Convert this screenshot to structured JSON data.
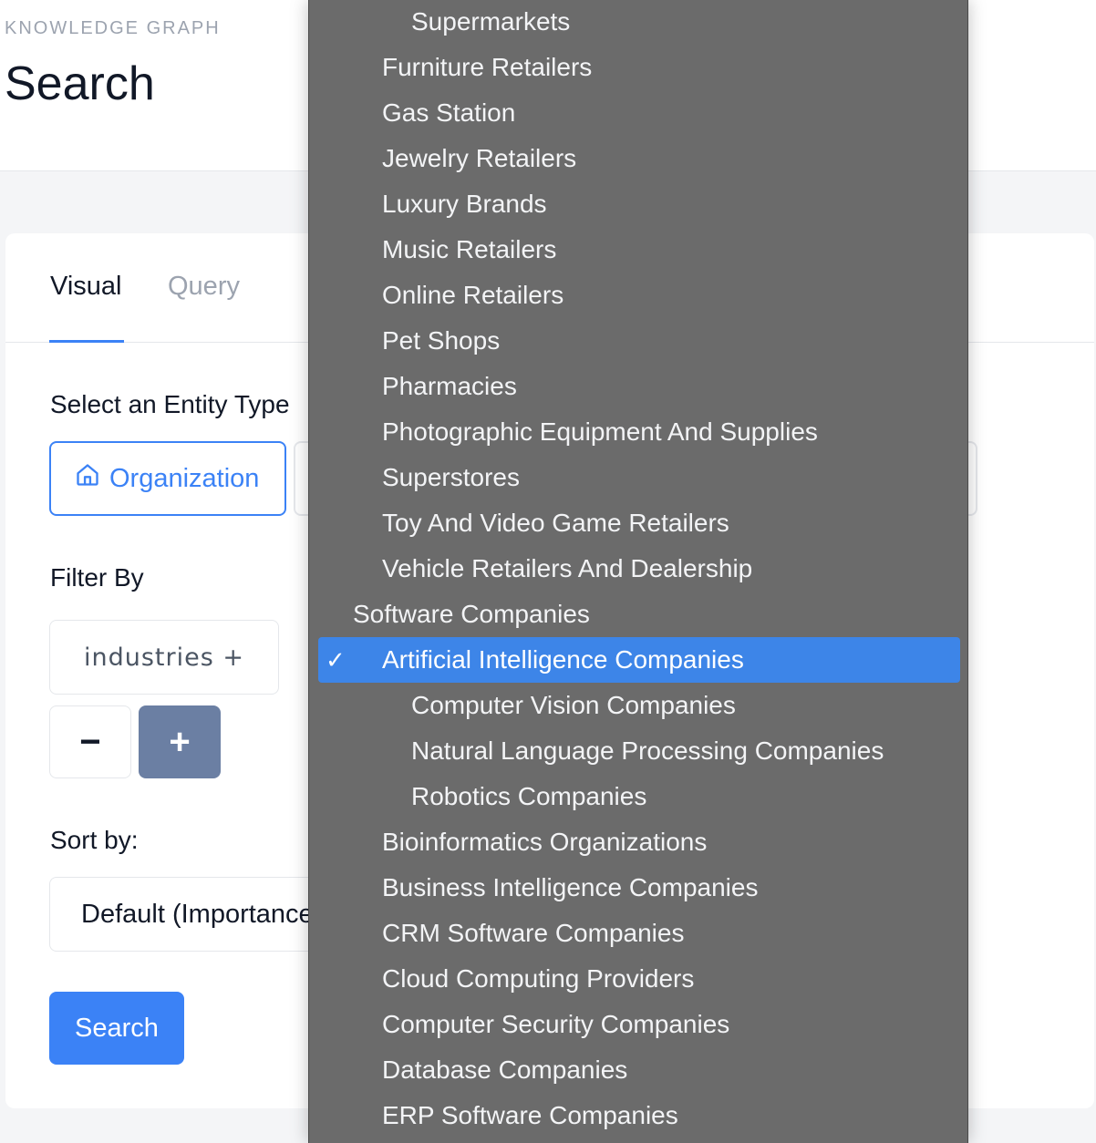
{
  "header": {
    "eyebrow": "KNOWLEDGE GRAPH",
    "title": "Search"
  },
  "tabs": [
    {
      "label": "Visual",
      "active": true
    },
    {
      "label": "Query",
      "active": false
    }
  ],
  "entity_section": {
    "label": "Select an Entity Type",
    "selected": "Organization",
    "selected_icon": "home-icon"
  },
  "filter_section": {
    "label": "Filter By",
    "chip": "industries +",
    "minus": "−",
    "plus": "+"
  },
  "sort_section": {
    "label": "Sort by:",
    "value": "Default (Importance"
  },
  "search_button": "Search",
  "colors": {
    "accent": "#3b82f6",
    "dropdown_bg": "#6b6b6b",
    "selected_bg": "#3d85e8"
  },
  "dropdown": {
    "options": [
      {
        "label": "Supermarkets",
        "level": 3
      },
      {
        "label": "Furniture Retailers",
        "level": 2
      },
      {
        "label": "Gas Station",
        "level": 2
      },
      {
        "label": "Jewelry Retailers",
        "level": 2
      },
      {
        "label": "Luxury Brands",
        "level": 2
      },
      {
        "label": "Music Retailers",
        "level": 2
      },
      {
        "label": "Online Retailers",
        "level": 2
      },
      {
        "label": "Pet Shops",
        "level": 2
      },
      {
        "label": "Pharmacies",
        "level": 2
      },
      {
        "label": "Photographic Equipment And Supplies",
        "level": 2
      },
      {
        "label": "Superstores",
        "level": 2
      },
      {
        "label": "Toy And Video Game Retailers",
        "level": 2
      },
      {
        "label": "Vehicle Retailers And Dealership",
        "level": 2
      },
      {
        "label": "Software Companies",
        "level": 1
      },
      {
        "label": "Artificial Intelligence Companies",
        "level": 2,
        "selected": true,
        "check": "✓"
      },
      {
        "label": "Computer Vision Companies",
        "level": 3
      },
      {
        "label": "Natural Language Processing Companies",
        "level": 3
      },
      {
        "label": "Robotics Companies",
        "level": 3
      },
      {
        "label": "Bioinformatics Organizations",
        "level": 2
      },
      {
        "label": "Business Intelligence Companies",
        "level": 2
      },
      {
        "label": "CRM Software Companies",
        "level": 2
      },
      {
        "label": "Cloud Computing Providers",
        "level": 2
      },
      {
        "label": "Computer Security Companies",
        "level": 2
      },
      {
        "label": "Database Companies",
        "level": 2
      },
      {
        "label": "ERP Software Companies",
        "level": 2
      }
    ]
  }
}
